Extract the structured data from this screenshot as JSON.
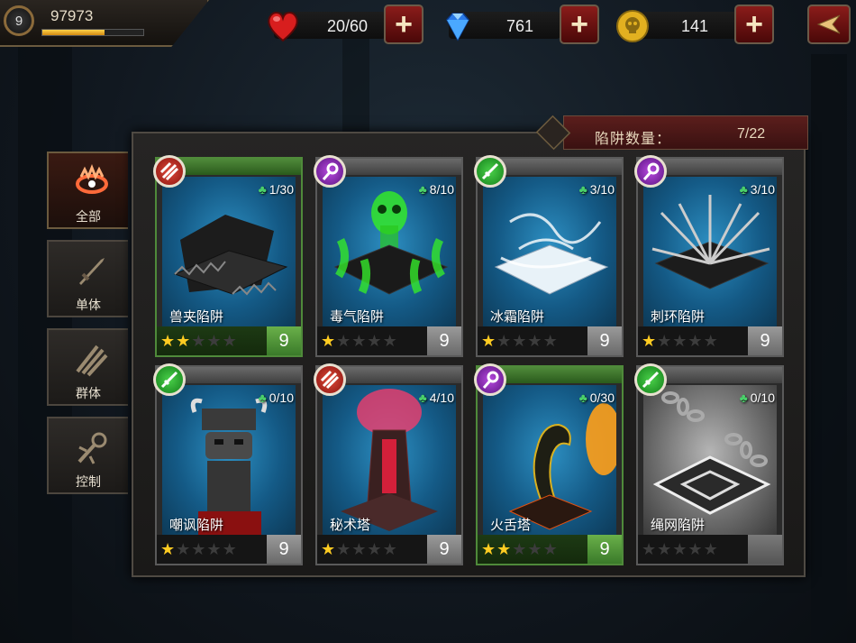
{
  "player": {
    "level": "9",
    "score": "97973",
    "xp_fraction": 0.62
  },
  "resources": [
    {
      "icon": "heart-icon",
      "value": "20/60"
    },
    {
      "icon": "diamond-icon",
      "value": "761"
    },
    {
      "icon": "gold-skull-coin-icon",
      "value": "141"
    }
  ],
  "trap_count": {
    "label": "陷阱数量：",
    "value": "7/22"
  },
  "tabs": [
    {
      "label": "全部",
      "icon": "all-traps-icon",
      "active": true
    },
    {
      "label": "单体",
      "icon": "single-target-icon",
      "active": false
    },
    {
      "label": "群体",
      "icon": "group-attack-icon",
      "active": false
    },
    {
      "label": "控制",
      "icon": "control-icon",
      "active": false
    }
  ],
  "cards": [
    {
      "name": "兽夹陷阱",
      "count": "1/30",
      "stars": 2,
      "level": "9",
      "badge": "red",
      "frame": "green",
      "art": "beast-trap"
    },
    {
      "name": "毒气陷阱",
      "count": "8/10",
      "stars": 1,
      "level": "9",
      "badge": "purple",
      "frame": "normal",
      "art": "poison-gas"
    },
    {
      "name": "冰霜陷阱",
      "count": "3/10",
      "stars": 1,
      "level": "9",
      "badge": "green",
      "frame": "normal",
      "art": "frost"
    },
    {
      "name": "刺环陷阱",
      "count": "3/10",
      "stars": 1,
      "level": "9",
      "badge": "purple",
      "frame": "normal",
      "art": "spike-ring"
    },
    {
      "name": "嘲讽陷阱",
      "count": "0/10",
      "stars": 1,
      "level": "9",
      "badge": "green",
      "frame": "normal",
      "art": "taunt-totem"
    },
    {
      "name": "秘术塔",
      "count": "4/10",
      "stars": 1,
      "level": "9",
      "badge": "red",
      "frame": "normal",
      "art": "arcane-tower"
    },
    {
      "name": "火舌塔",
      "count": "0/30",
      "stars": 2,
      "level": "9",
      "badge": "purple",
      "frame": "green",
      "art": "fire-cobra"
    },
    {
      "name": "绳网陷阱",
      "count": "0/10",
      "stars": 0,
      "level": "",
      "badge": "green",
      "frame": "gray",
      "art": "chain-net"
    }
  ],
  "colors": {
    "accent_red": "#8a1c1a",
    "star_gold": "#ffcc22",
    "card_blue": "#1e74a6",
    "frame_green": "#4f8a3a"
  }
}
